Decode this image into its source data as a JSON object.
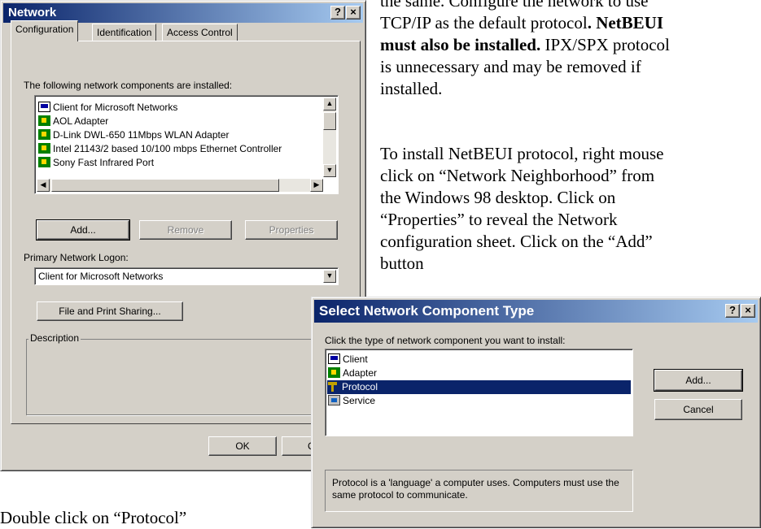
{
  "network_dialog": {
    "title": "Network",
    "help_btn": "?",
    "close_btn": "×",
    "tabs": [
      "Configuration",
      "Identification",
      "Access Control"
    ],
    "components_label": "The following network components are installed:",
    "components": [
      {
        "icon": "client-icon",
        "label": "Client for Microsoft Networks"
      },
      {
        "icon": "adapter-icon",
        "label": "AOL Adapter"
      },
      {
        "icon": "adapter-icon",
        "label": "D-Link DWL-650 11Mbps WLAN Adapter"
      },
      {
        "icon": "adapter-icon",
        "label": "Intel 21143/2 based 10/100 mbps Ethernet Controller"
      },
      {
        "icon": "adapter-icon",
        "label": "Sony Fast Infrared Port"
      }
    ],
    "add_btn": "Add...",
    "remove_btn": "Remove",
    "properties_btn": "Properties",
    "primary_logon_label": "Primary Network Logon:",
    "primary_logon_value": "Client for Microsoft Networks",
    "file_print_btn": "File and Print Sharing...",
    "description_label": "Description",
    "ok_btn": "OK",
    "cancel_btn_partial": "C"
  },
  "select_dialog": {
    "title": "Select Network Component Type",
    "help_btn": "?",
    "close_btn": "×",
    "prompt": "Click the type of network component you want to install:",
    "types": [
      {
        "icon": "client-icon",
        "label": "Client",
        "selected": false
      },
      {
        "icon": "adapter-icon",
        "label": "Adapter",
        "selected": false
      },
      {
        "icon": "protocol-icon",
        "label": "Protocol",
        "selected": true
      },
      {
        "icon": "service-icon",
        "label": "Service",
        "selected": false
      }
    ],
    "add_btn": "Add...",
    "cancel_btn": "Cancel",
    "description": "Protocol is a 'language' a computer uses. Computers must use the same protocol to communicate."
  },
  "document": {
    "p1_line0": "the same. Configure the network to use",
    "p1_line1_a": "TCP/IP as the default protocol",
    "p1_line1_b": ". NetBEUI",
    "p1_line2_bold": "must also be installed.",
    "p1_line2_rest": " IPX/SPX protocol",
    "p1_line3": "is unnecessary and may be removed if",
    "p1_line4": "installed.",
    "p2_line1": "To install NetBEUI protocol, right mouse",
    "p2_line2": "click on “Network Neighborhood” from",
    "p2_line3": "the Windows 98 desktop. Click on",
    "p2_line4": "“Properties” to reveal the Network",
    "p2_line5": "configuration sheet. Click on the “Add”",
    "p2_line6": "button",
    "footer": "Double click on “Protocol”"
  }
}
